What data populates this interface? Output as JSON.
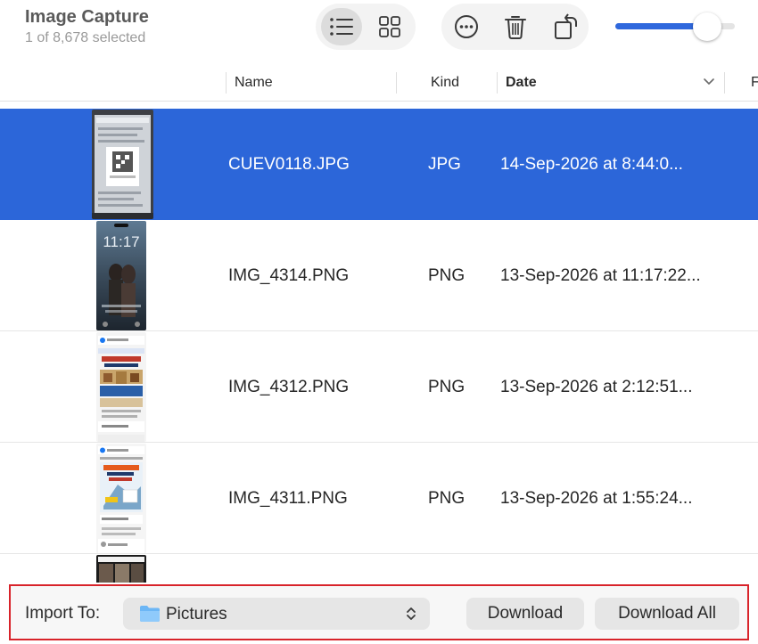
{
  "window": {
    "title": "Image Capture",
    "selection_status": "1 of 8,678 selected"
  },
  "toolbar": {
    "view_mode": "list",
    "icons": [
      "list-view-icon",
      "grid-view-icon",
      "more-options-icon",
      "trash-icon",
      "rotate-icon"
    ],
    "thumbnail_size_fraction": 0.85
  },
  "columns": [
    {
      "key": "name",
      "label": "Name"
    },
    {
      "key": "kind",
      "label": "Kind"
    },
    {
      "key": "date",
      "label": "Date",
      "sorted": true
    },
    {
      "key": "extra",
      "label": "F"
    }
  ],
  "files": [
    {
      "name": "CUEV0118.JPG",
      "kind": "JPG",
      "date": "14-Sep-2026 at 8:44:0...",
      "selected": true
    },
    {
      "name": "IMG_4314.PNG",
      "kind": "PNG",
      "date": "13-Sep-2026 at 11:17:22...",
      "selected": false
    },
    {
      "name": "IMG_4312.PNG",
      "kind": "PNG",
      "date": "13-Sep-2026 at 2:12:51...",
      "selected": false
    },
    {
      "name": "IMG_4311.PNG",
      "kind": "PNG",
      "date": "13-Sep-2026 at 1:55:24...",
      "selected": false
    }
  ],
  "thumbnails": {
    "lockscreen_time": "11:17"
  },
  "import": {
    "label": "Import To:",
    "destination": "Pictures",
    "download_label": "Download",
    "download_all_label": "Download All"
  },
  "colors": {
    "accent": "#2c66d9",
    "highlight_border": "#d8232a"
  }
}
